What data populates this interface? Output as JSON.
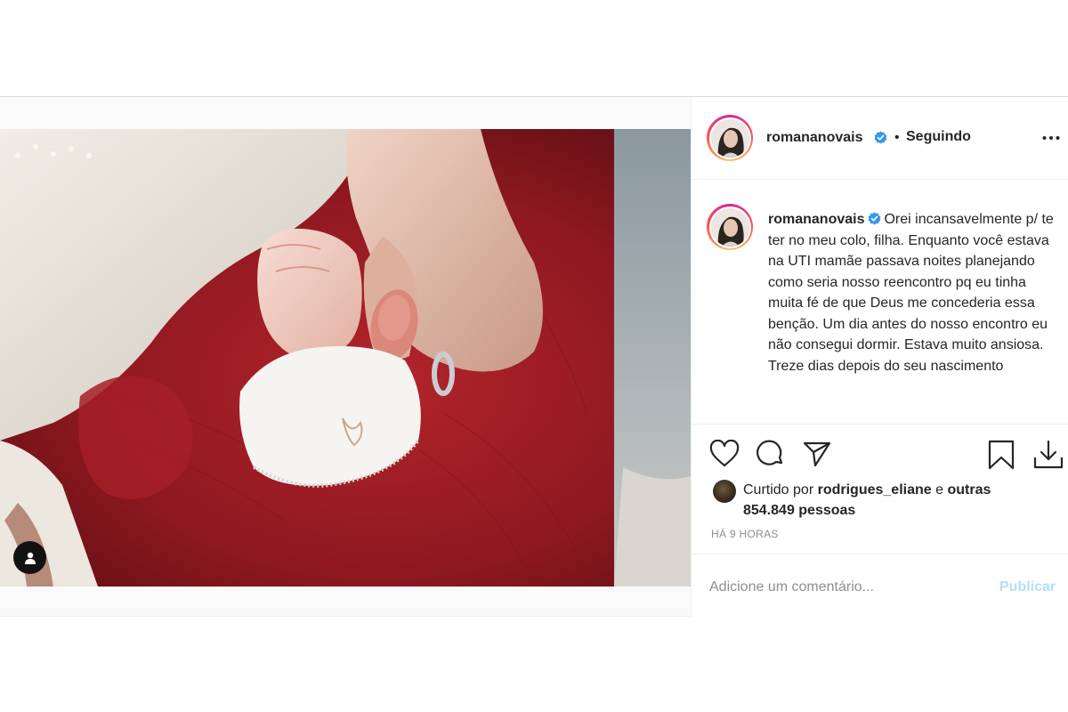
{
  "post": {
    "author": {
      "username": "romananovais",
      "verified": true,
      "follow_status": "Seguindo",
      "separator": "•"
    },
    "caption": {
      "username": "romananovais",
      "text": "Orei incansavelmente p/ te ter no meu colo, filha. Enquanto você estava na UTI mamãe passava noites planejando como seria nosso reencontro pq eu tinha muita fé de que Deus me concederia essa benção. Um dia antes do nosso encontro eu não consegui dormir. Estava muito ansiosa. Treze dias depois do seu nascimento"
    },
    "likes": {
      "prefix": "Curtido por",
      "liker": "rodrigues_eliane",
      "joiner": "e",
      "others": "outras 854.849 pessoas"
    },
    "timestamp": "HÁ 9 HORAS",
    "comment": {
      "placeholder": "Adicione um comentário...",
      "publish_label": "Publicar"
    }
  },
  "icons": {
    "more": "more-options-icon",
    "like": "heart-icon",
    "comment": "comment-icon",
    "share": "paper-plane-icon",
    "save": "bookmark-icon",
    "download": "download-icon",
    "user_tag": "user-tag-icon",
    "verified": "verified-badge-icon"
  },
  "colors": {
    "verified": "#3897f0",
    "publish_disabled": "#b2dffc",
    "muted": "#8e8e8e"
  }
}
